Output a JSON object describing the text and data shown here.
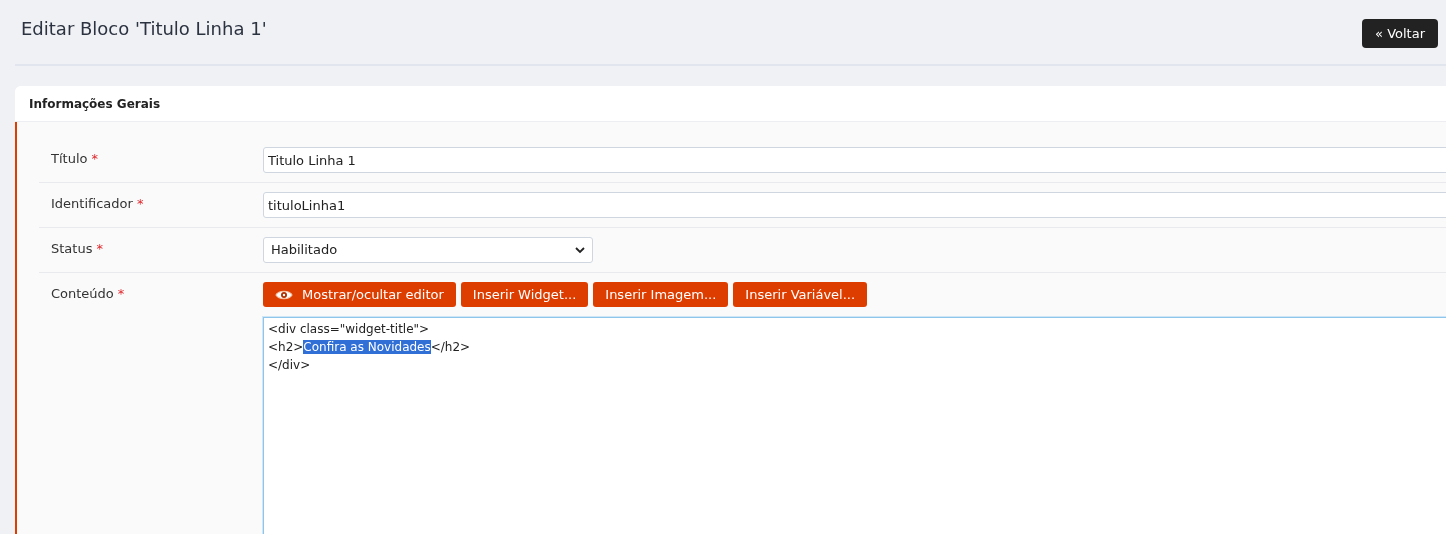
{
  "page_title": "Editar Bloco 'Titulo Linha 1'",
  "back_button": "« Voltar",
  "card": {
    "title": "Informações Gerais",
    "fields": [
      {
        "kind": "text",
        "label": "Título",
        "required_mark": "*",
        "value": "Titulo Linha 1"
      },
      {
        "kind": "text",
        "label": "Identificador",
        "required_mark": "*",
        "value": "tituloLinha1"
      },
      {
        "kind": "select",
        "label": "Status",
        "required_mark": "*",
        "value": "Habilitado"
      },
      {
        "kind": "editor",
        "label": "Conteúdo",
        "required_mark": "*",
        "buttons": [
          {
            "label": "Mostrar/ocultar editor",
            "kind": "toggle"
          },
          {
            "label": "Inserir Widget...",
            "kind": "insert"
          },
          {
            "label": "Inserir Imagem...",
            "kind": "insert"
          },
          {
            "label": "Inserir Variável...",
            "kind": "insert"
          }
        ],
        "lines": [
          [
            {
              "text": "<div class=\"widget-title\">",
              "selected": false
            }
          ],
          [
            {
              "text": "<h2>",
              "selected": false
            },
            {
              "text": "Confira as Novidades",
              "selected": true
            },
            {
              "text": "</h2>",
              "selected": false
            }
          ],
          [
            {
              "text": "</div>",
              "selected": false
            }
          ]
        ]
      }
    ]
  }
}
